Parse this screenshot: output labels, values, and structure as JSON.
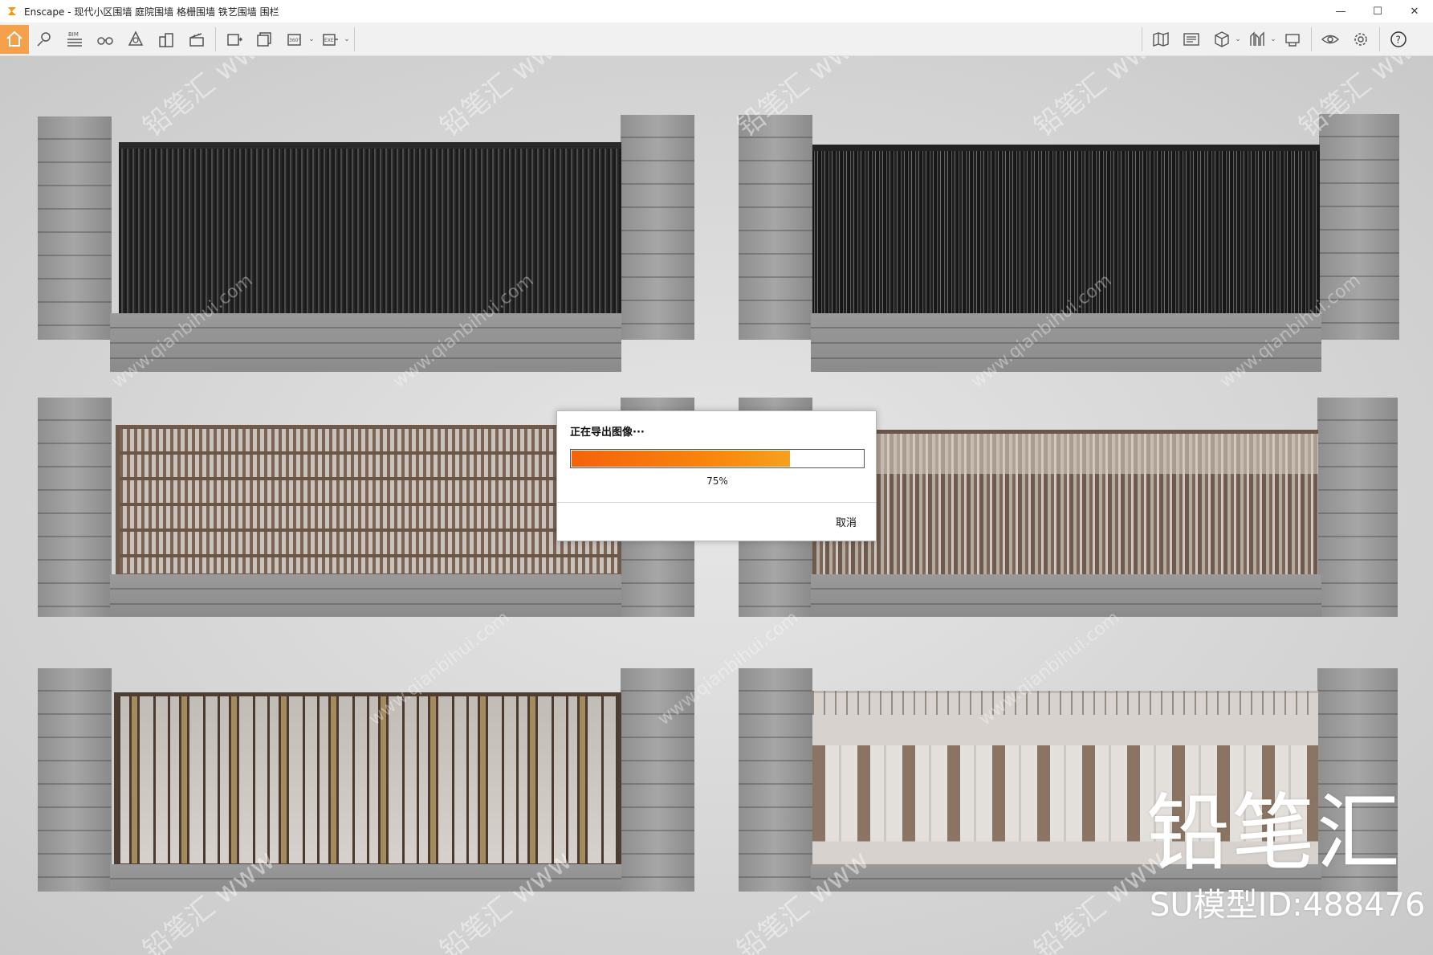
{
  "window": {
    "title": "Enscape - 现代小区围墙 庭院围墙 格栅围墙 铁艺围墙 围栏",
    "controls": [
      "minimize-icon",
      "maximize-icon",
      "close-icon"
    ]
  },
  "toolbar": {
    "left_icons": [
      "home-icon",
      "place-marker-icon",
      "bim-icon",
      "binoculars-icon",
      "asset-library-icon",
      "buildings-icon",
      "video-editor-icon",
      "screenshot-icon",
      "batch-render-icon",
      "panorama-360-icon",
      "export-exe-icon"
    ],
    "bim_label": "BIM",
    "panorama_label": "360°",
    "exe_label": "EXE",
    "right_icons": [
      "map-icon",
      "view-management-icon",
      "cube-icon",
      "material-editor-icon",
      "collaboration-icon",
      "visual-settings-icon",
      "settings-icon",
      "help-icon"
    ],
    "help_label": "?",
    "accent_color": "#f5a04a"
  },
  "dialog": {
    "title": "正在导出图像···",
    "progress_value": 0.75,
    "progress_label": "75%",
    "cancel_label": "取消",
    "progress_color": "#f5620a"
  },
  "watermark": {
    "brand": "铅笔汇",
    "model_id": "SU模型ID:488476",
    "repeated_text": "铅笔汇 www",
    "url_text": "www.qianbihui.com"
  }
}
